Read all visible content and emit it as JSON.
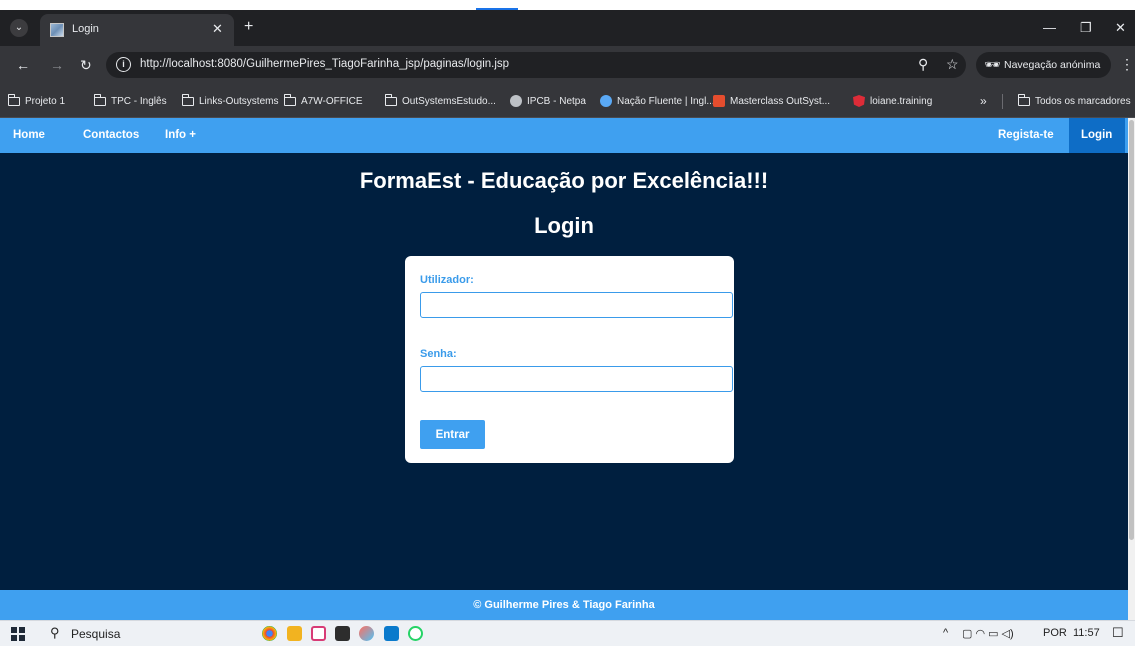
{
  "browser": {
    "tab_title": "Login",
    "url": "http://localhost:8080/GuilhermePires_TiagoFarinha_jsp/paginas/login.jsp",
    "incognito_label": "Navegação anónima",
    "bookmarks": [
      {
        "label": "Projeto 1",
        "icon": "folder-icon"
      },
      {
        "label": "TPC - Inglês",
        "icon": "folder-icon"
      },
      {
        "label": "Links-Outsystems",
        "icon": "folder-icon"
      },
      {
        "label": "A7W-OFFICE",
        "icon": "folder-icon"
      },
      {
        "label": "OutSystemsEstudo...",
        "icon": "folder-icon"
      },
      {
        "label": "IPCB - Netpa",
        "icon": "globe-icon"
      },
      {
        "label": "Nação Fluente | Ingl...",
        "icon": "site-icon"
      },
      {
        "label": "Masterclass OutSyst...",
        "icon": "site-icon"
      },
      {
        "label": "loiane.training",
        "icon": "angular-icon"
      }
    ],
    "all_bookmarks": "Todos os marcadores",
    "overflow": "»"
  },
  "nav": {
    "home": "Home",
    "contactos": "Contactos",
    "info": "Info +",
    "registar": "Regista-te",
    "login": "Login"
  },
  "page": {
    "title": "FormaEst - Educação por Excelência!!!",
    "subtitle": "Login"
  },
  "form": {
    "user_label": "Utilizador:",
    "user_value": "",
    "pass_label": "Senha:",
    "pass_value": "",
    "submit_label": "Entrar"
  },
  "footer": {
    "text": "© Guilherme Pires & Tiago Farinha"
  },
  "taskbar": {
    "search_label": "Pesquisa",
    "language": "POR",
    "time": "11:57"
  },
  "colors": {
    "page_bg": "#001f3f",
    "accent": "#3fa0f0",
    "accent_active": "#0e6dc6"
  }
}
